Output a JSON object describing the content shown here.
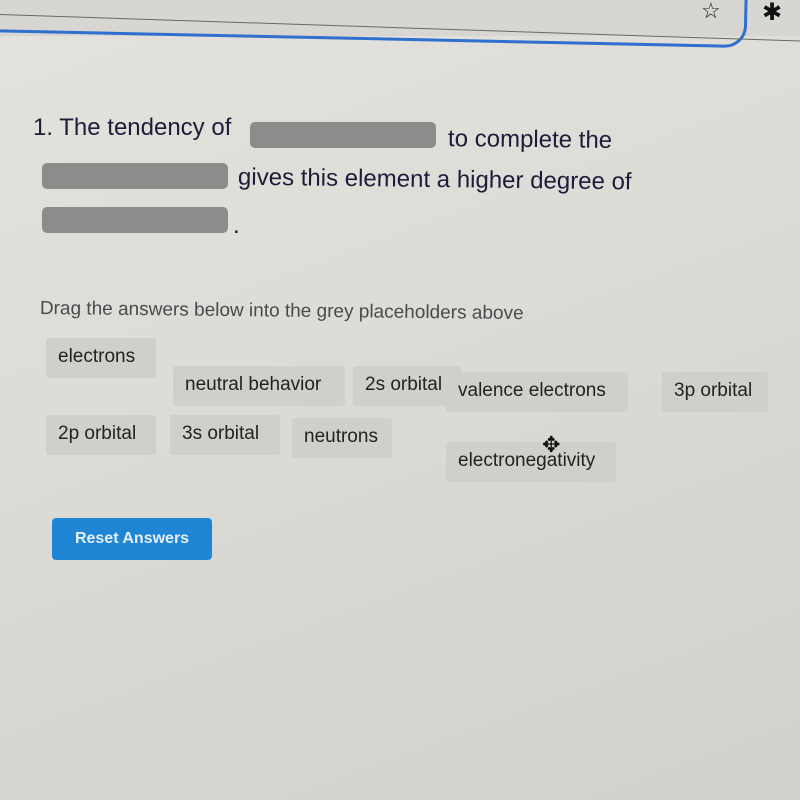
{
  "browser": {
    "icons": {
      "star": "☆",
      "puzzle": "✱"
    }
  },
  "question": {
    "line1_prefix": "1. The tendency of",
    "line1_suffix": "to complete the",
    "line2_suffix": "gives this element a higher degree of",
    "line3_suffix": "."
  },
  "instructions": "Drag the answers below into the grey placeholders above",
  "answers": [
    "electrons",
    "neutral behavior",
    "2s orbital",
    "valence electrons",
    "3p orbital",
    "2p orbital",
    "3s orbital",
    "neutrons",
    "electronegativity"
  ],
  "cursor_icon": "✥",
  "reset_button": "Reset Answers",
  "colors": {
    "accent": "#1f86d6",
    "placeholder": "#8e8c8a",
    "chip": "#cfcfcb"
  }
}
